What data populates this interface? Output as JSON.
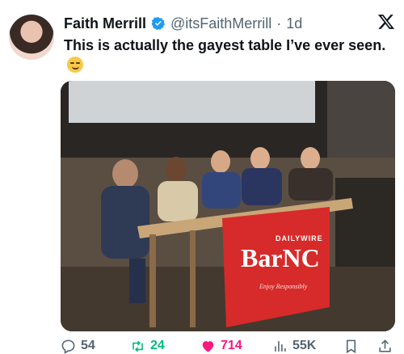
{
  "tweet": {
    "author_name": "Faith Merrill",
    "handle": "@itsFaithMerrill",
    "separator": "·",
    "time": "1d",
    "text": "This is actually the gayest table I’ve ever seen.",
    "emoji": "smirk-emoji"
  },
  "media": {
    "banner_brand": "DAILYWIRE",
    "banner_title_left": "Bar",
    "banner_title_right": "NC",
    "banner_tagline": "Enjoy Responsibly",
    "banner_color": "#d72a2a"
  },
  "actions": {
    "replies": "54",
    "reposts": "24",
    "likes": "714",
    "views": "55K"
  },
  "colors": {
    "verified": "#1d9bf0",
    "repost": "#00ba7c",
    "like": "#f91880",
    "muted": "#536471"
  }
}
